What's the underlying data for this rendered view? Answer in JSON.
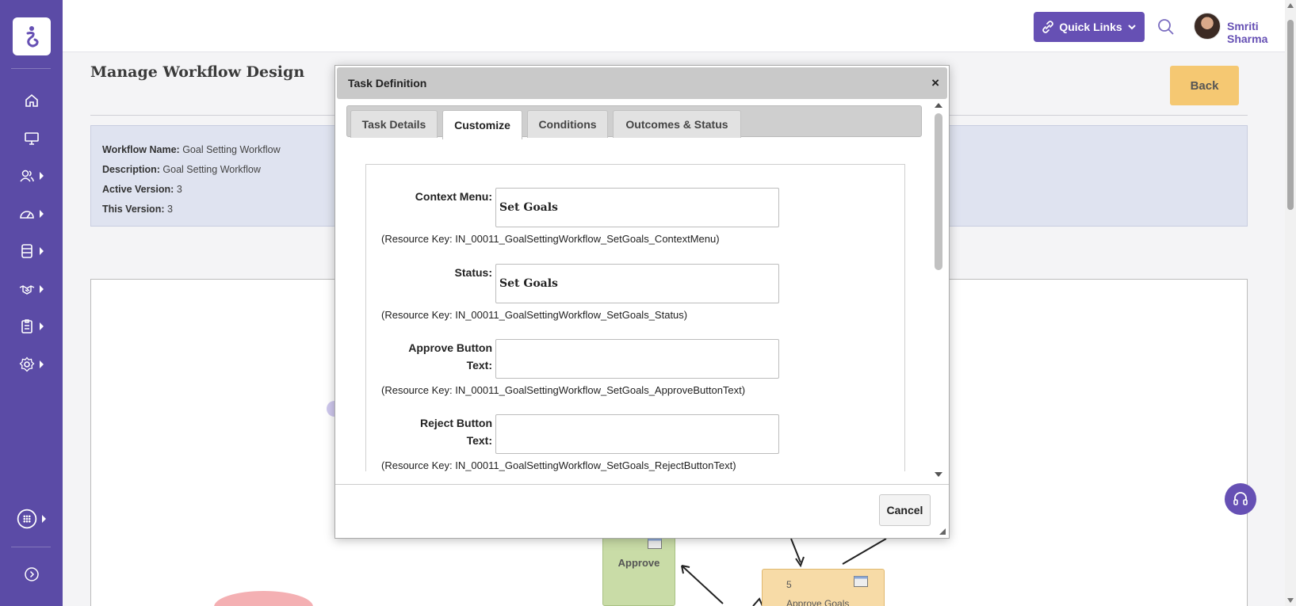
{
  "app": {
    "accent": "#5b4ba6",
    "button_accent": "#6650b4"
  },
  "header": {
    "quick_links_label": "Quick Links",
    "user_name": "Smriti Sharma"
  },
  "page": {
    "title": "Manage Workflow Design",
    "back_label": "Back",
    "info": {
      "workflow_name_label": "Workflow Name:",
      "workflow_name_value": "Goal Setting Workflow",
      "description_label": "Description:",
      "description_value": "Goal Setting Workflow",
      "active_version_label": "Active Version:",
      "active_version_value": "3",
      "this_version_label": "This Version:",
      "this_version_value": "3"
    }
  },
  "diagram": {
    "approve_label": "Approve",
    "approve_goals_number": "5",
    "approve_goals_label": "Approve Goals"
  },
  "dialog": {
    "title": "Task Definition",
    "close_label": "×",
    "tabs": [
      {
        "label": "Task Details",
        "active": false
      },
      {
        "label": "Customize",
        "active": true
      },
      {
        "label": "Conditions",
        "active": false
      },
      {
        "label": "Outcomes & Status",
        "active": false
      }
    ],
    "fields": [
      {
        "label": "Context Menu:",
        "value": "Set Goals",
        "resource_key": "(Resource Key: IN_00011_GoalSettingWorkflow_SetGoals_ContextMenu)"
      },
      {
        "label": "Status:",
        "value": "Set Goals",
        "resource_key": "(Resource Key: IN_00011_GoalSettingWorkflow_SetGoals_Status)"
      },
      {
        "label_line1": "Approve Button",
        "label_line2": "Text:",
        "value": "",
        "resource_key": "(Resource Key: IN_00011_GoalSettingWorkflow_SetGoals_ApproveButtonText)"
      },
      {
        "label_line1": "Reject Button",
        "label_line2": "Text:",
        "value": "",
        "resource_key": "(Resource Key: IN_00011_GoalSettingWorkflow_SetGoals_RejectButtonText)"
      }
    ],
    "cancel_label": "Cancel"
  },
  "icons": {
    "sidebar": [
      "home-icon",
      "monitor-icon",
      "people-icon",
      "dashboard-icon",
      "database-icon",
      "handshake-icon",
      "clipboard-icon",
      "settings-icon",
      "apps-icon",
      "expand-icon"
    ],
    "header": [
      "link-icon",
      "search-icon",
      "chevron-down-icon"
    ],
    "help": "headset-icon"
  }
}
